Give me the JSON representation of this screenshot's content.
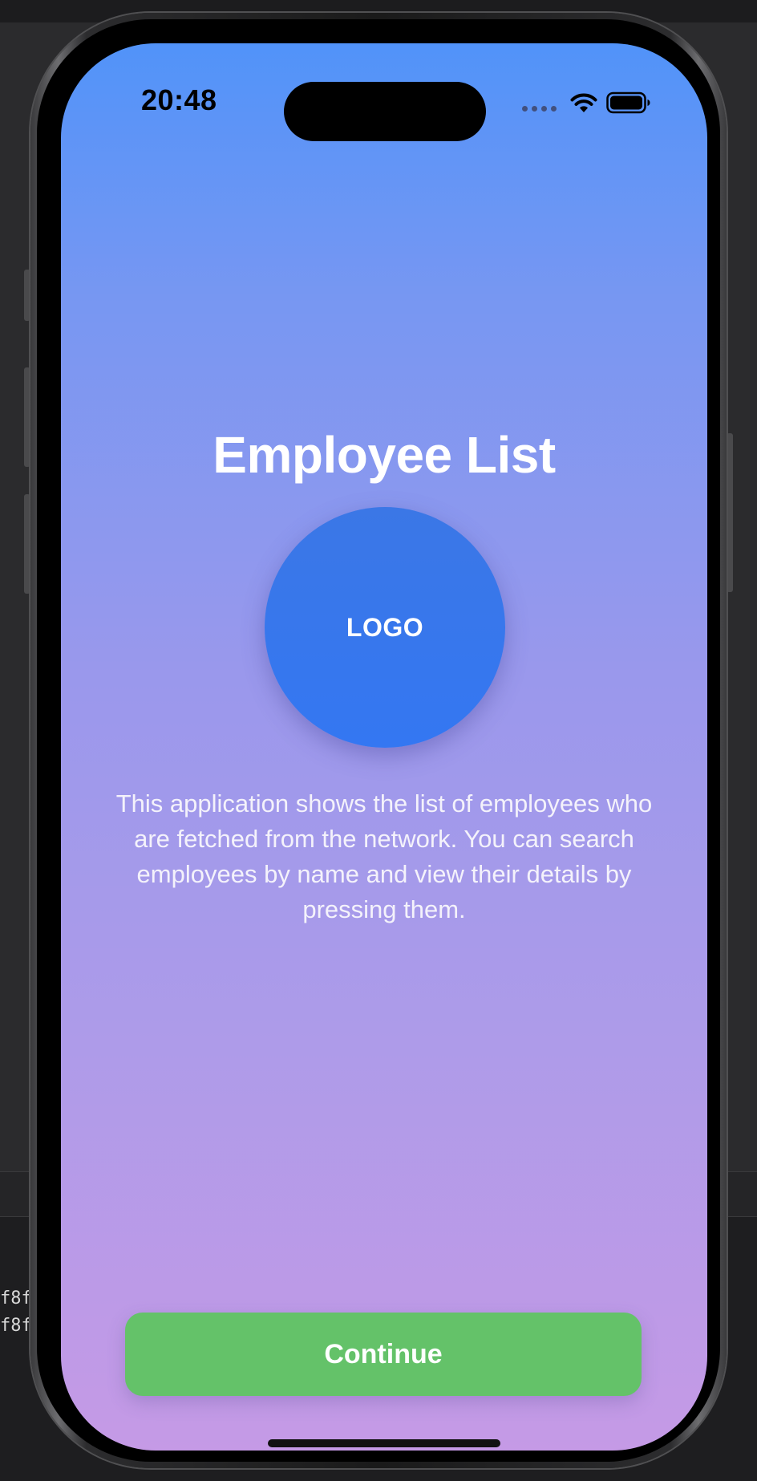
{
  "status_bar": {
    "time": "20:48",
    "signal_icon": "signal-dots-icon",
    "wifi_icon": "wifi-icon",
    "battery_icon": "battery-icon"
  },
  "welcome": {
    "title": "Employee List",
    "logo_text": "LOGO",
    "description": "This application shows the list of employees who are fetched from the network. You can search employees by name and view their details by pressing them.",
    "continue_label": "Continue"
  },
  "console": {
    "lines": [
      "f8f",
      "f8f"
    ]
  },
  "colors": {
    "gradient_top": "#5193f9",
    "gradient_bottom": "#c59ae6",
    "logo_fill": "#3477f2",
    "continue_button": "#64c269",
    "text": "#ffffff"
  }
}
